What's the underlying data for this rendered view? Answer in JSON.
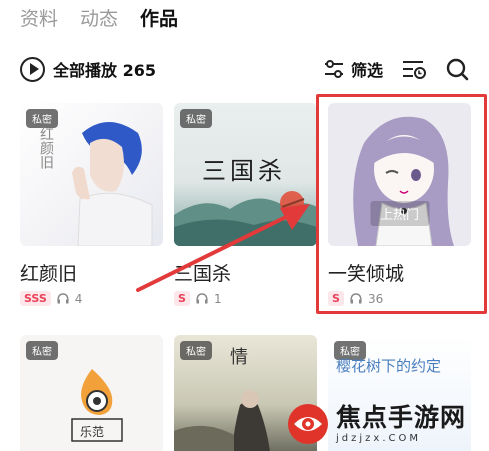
{
  "tabs": [
    {
      "label": "资料"
    },
    {
      "label": "动态"
    },
    {
      "label": "作品"
    }
  ],
  "toolbar": {
    "play_all_label": "全部播放 265",
    "filter_label": "筛选"
  },
  "cards": [
    {
      "badge": "私密",
      "cover_text": "红颜旧",
      "title": "红颜旧",
      "level": "SSS",
      "listens": "4"
    },
    {
      "badge": "私密",
      "cover_text": "三国杀",
      "title": "三国杀",
      "level": "S",
      "listens": "1"
    },
    {
      "badge": "",
      "cover_text": "上热门",
      "title": "一笑倾城",
      "level": "S",
      "listens": "36"
    },
    {
      "badge": "私密",
      "cover_text": "乐范"
    },
    {
      "badge": "私密",
      "cover_text": "情"
    },
    {
      "badge": "私密",
      "cover_text": "樱花树下的约定"
    }
  ],
  "watermark": {
    "main": "焦点手游网",
    "sub": "jdzjzx.COM"
  },
  "colors": {
    "highlight": "#e23a3a",
    "level_text": "#e8435a",
    "level_bg": "#fde7ea"
  }
}
